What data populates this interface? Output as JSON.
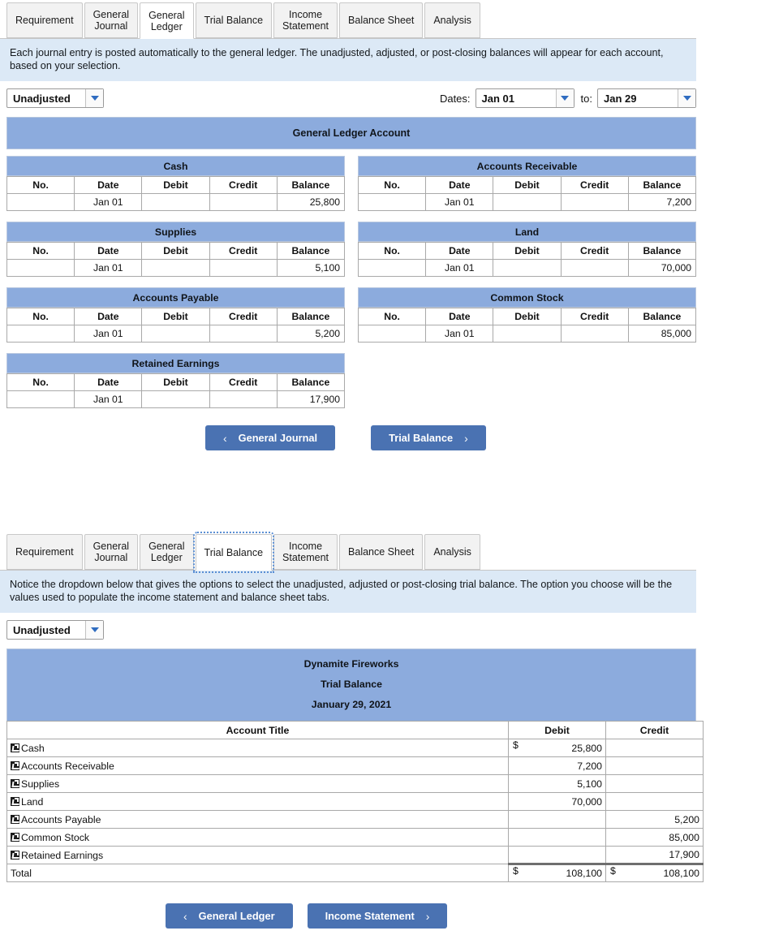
{
  "tabs": [
    "Requirement",
    "General\nJournal",
    "General\nLedger",
    "Trial Balance",
    "Income\nStatement",
    "Balance Sheet",
    "Analysis"
  ],
  "colors": {
    "header_blue": "#8cabdd",
    "banner_blue": "#dce9f6",
    "button_blue": "#4a72b2",
    "caret_blue": "#2f6cc0"
  },
  "ledger_panel": {
    "active_tab": "General\nLedger",
    "banner": "Each journal entry is posted automatically to the general ledger. The unadjusted, adjusted, or post-closing balances will appear for each account, based on your selection.",
    "controls": {
      "basis_value": "Unadjusted",
      "dates_label": "Dates:",
      "date_from": "Jan 01",
      "to_label": "to:",
      "date_to": "Jan 29"
    },
    "grid_title": "General Ledger Account",
    "columns": [
      "No.",
      "Date",
      "Debit",
      "Credit",
      "Balance"
    ],
    "accounts": [
      {
        "name": "Cash",
        "rows": [
          {
            "no": "",
            "date": "Jan 01",
            "debit": "",
            "credit": "",
            "balance": "25,800"
          }
        ]
      },
      {
        "name": "Accounts Receivable",
        "rows": [
          {
            "no": "",
            "date": "Jan 01",
            "debit": "",
            "credit": "",
            "balance": "7,200"
          }
        ]
      },
      {
        "name": "Supplies",
        "rows": [
          {
            "no": "",
            "date": "Jan 01",
            "debit": "",
            "credit": "",
            "balance": "5,100"
          }
        ]
      },
      {
        "name": "Land",
        "rows": [
          {
            "no": "",
            "date": "Jan 01",
            "debit": "",
            "credit": "",
            "balance": "70,000"
          }
        ]
      },
      {
        "name": "Accounts Payable",
        "rows": [
          {
            "no": "",
            "date": "Jan 01",
            "debit": "",
            "credit": "",
            "balance": "5,200"
          }
        ]
      },
      {
        "name": "Common Stock",
        "rows": [
          {
            "no": "",
            "date": "Jan 01",
            "debit": "",
            "credit": "",
            "balance": "85,000"
          }
        ]
      },
      {
        "name": "Retained Earnings",
        "rows": [
          {
            "no": "",
            "date": "Jan 01",
            "debit": "",
            "credit": "",
            "balance": "17,900"
          }
        ]
      }
    ],
    "nav": {
      "prev_label": "General Journal",
      "next_label": "Trial Balance",
      "prev_chevron": "‹",
      "next_chevron": "›"
    }
  },
  "trial_panel": {
    "active_tab": "Trial Balance",
    "banner": "Notice the dropdown below that gives the options to select the unadjusted, adjusted or post-closing trial balance. The option you choose will be the values used to populate the income statement and balance sheet tabs.",
    "controls": {
      "basis_value": "Unadjusted"
    },
    "report_header": {
      "company": "Dynamite Fireworks",
      "statement": "Trial Balance",
      "date": "January 29, 2021"
    },
    "columns": [
      "Account Title",
      "Debit",
      "Credit"
    ],
    "rows": [
      {
        "title": "Cash",
        "debit_symbol": "$",
        "debit": "25,800",
        "credit_symbol": "",
        "credit": ""
      },
      {
        "title": "Accounts Receivable",
        "debit_symbol": "",
        "debit": "7,200",
        "credit_symbol": "",
        "credit": ""
      },
      {
        "title": "Supplies",
        "debit_symbol": "",
        "debit": "5,100",
        "credit_symbol": "",
        "credit": ""
      },
      {
        "title": "Land",
        "debit_symbol": "",
        "debit": "70,000",
        "credit_symbol": "",
        "credit": ""
      },
      {
        "title": "Accounts Payable",
        "debit_symbol": "",
        "debit": "",
        "credit_symbol": "",
        "credit": "5,200"
      },
      {
        "title": "Common Stock",
        "debit_symbol": "",
        "debit": "",
        "credit_symbol": "",
        "credit": "85,000"
      },
      {
        "title": "Retained Earnings",
        "debit_symbol": "",
        "debit": "",
        "credit_symbol": "",
        "credit": "17,900"
      }
    ],
    "total_row": {
      "title": "Total",
      "debit_symbol": "$",
      "debit": "108,100",
      "credit_symbol": "$",
      "credit": "108,100"
    },
    "nav": {
      "prev_label": "General Ledger",
      "next_label": "Income Statement",
      "prev_chevron": "‹",
      "next_chevron": "›"
    }
  }
}
